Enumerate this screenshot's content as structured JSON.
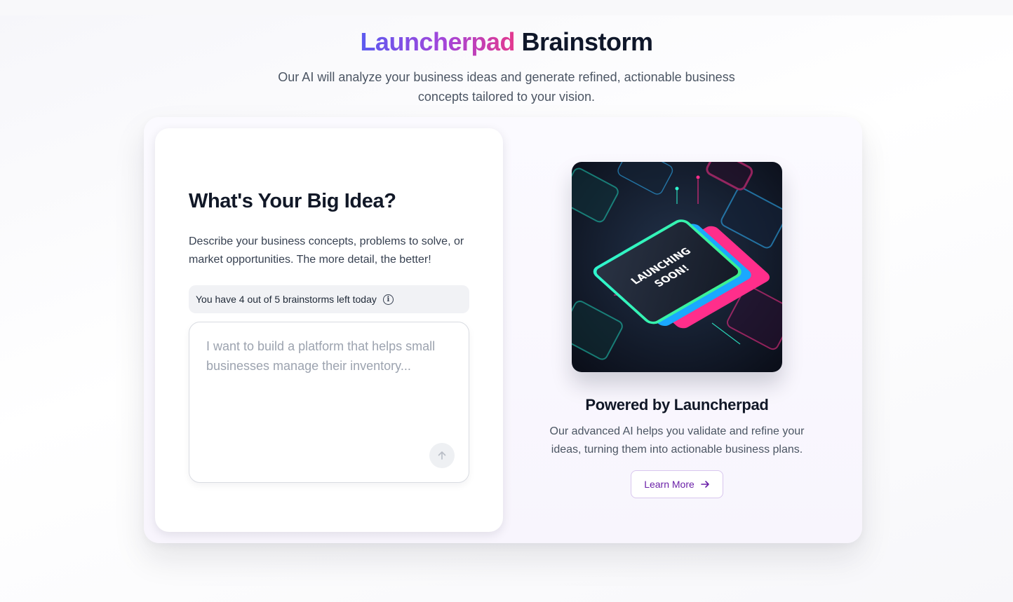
{
  "hero": {
    "title_brand": "Launcherpad",
    "title_rest": "Brainstorm",
    "subtitle": "Our AI will analyze your business ideas and generate refined, actionable business concepts tailored to your vision."
  },
  "form": {
    "heading": "What's Your Big Idea?",
    "description": "Describe your business concepts, problems to solve, or market opportunities. The more detail, the better!",
    "quota_text": "You have 4 out of 5 brainstorms left today",
    "quota_icon": "info-icon",
    "idea_value": "",
    "idea_placeholder": "I want to build a platform that helps small businesses manage their inventory...",
    "send_icon": "arrow-up-icon"
  },
  "promo": {
    "image_text_line1": "LAUNCHING",
    "image_text_line2": "SOON!",
    "heading": "Powered by Launcherpad",
    "description": "Our advanced AI helps you validate and refine your ideas, turning them into actionable business plans.",
    "button_label": "Learn More",
    "button_icon": "arrow-right-icon"
  },
  "colors": {
    "brand_start": "#5b5bf0",
    "brand_end": "#e3398e",
    "accent_purple": "#6b21a8"
  }
}
